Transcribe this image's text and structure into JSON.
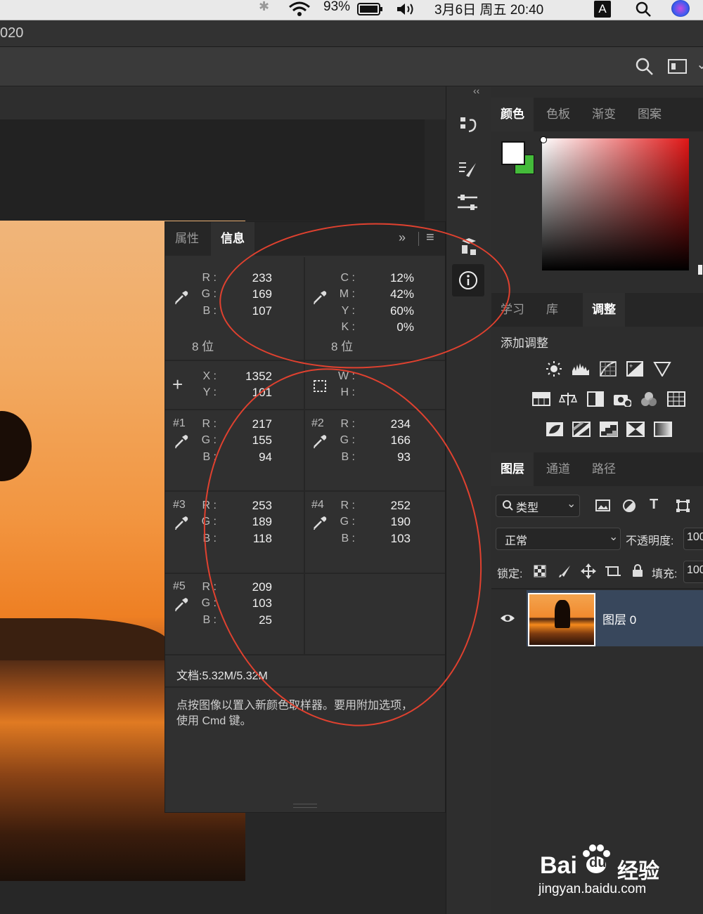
{
  "menubar": {
    "battery": "93%",
    "datetime": "3月6日 周五  20:40",
    "input_source": "A"
  },
  "window": {
    "title": "020"
  },
  "info_panel": {
    "tabs": [
      "属性",
      "信息"
    ],
    "rgb": {
      "r_label": "R :",
      "g_label": "G :",
      "b_label": "B :",
      "r": "233",
      "g": "169",
      "b": "107",
      "bits": "8 位"
    },
    "cmyk": {
      "c_label": "C :",
      "m_label": "M :",
      "y_label": "Y :",
      "k_label": "K :",
      "c": "12%",
      "m": "42%",
      "y": "60%",
      "k": "0%",
      "bits": "8 位"
    },
    "position": {
      "x_label": "X :",
      "y_label": "Y :",
      "x": "1352",
      "y": "101"
    },
    "size": {
      "w_label": "W :",
      "h_label": "H :"
    },
    "samplers": [
      {
        "id": "#1",
        "r": "217",
        "g": "155",
        "b": "94"
      },
      {
        "id": "#2",
        "r": "234",
        "g": "166",
        "b": "93"
      },
      {
        "id": "#3",
        "r": "253",
        "g": "189",
        "b": "118"
      },
      {
        "id": "#4",
        "r": "252",
        "g": "190",
        "b": "103"
      },
      {
        "id": "#5",
        "r": "209",
        "g": "103",
        "b": "25"
      }
    ],
    "doc_size": "文档:5.32M/5.32M",
    "hint": "点按图像以置入新颜色取样器。要用附加选项，使用 Cmd 键。"
  },
  "color_panel": {
    "tabs": [
      "颜色",
      "色板",
      "渐变",
      "图案"
    ]
  },
  "adjust_panel": {
    "tabs": [
      "学习",
      "库",
      "调整"
    ],
    "heading": "添加调整"
  },
  "layers_panel": {
    "tabs": [
      "图层",
      "通道",
      "路径"
    ],
    "filter_kind": "类型",
    "blend_mode": "正常",
    "opacity_label": "不透明度:",
    "opacity_value": "100",
    "lock_label": "锁定:",
    "fill_label": "填充:",
    "fill_value": "100",
    "layer_name": "图层 0"
  },
  "watermark": {
    "brand": "Bai",
    "brand2": "du",
    "cn": "经验",
    "url": "jingyan.baidu.com"
  },
  "colors": {
    "annotation": "#e0412f",
    "layer_selected": "#38475c",
    "panel_bg": "#303030"
  }
}
